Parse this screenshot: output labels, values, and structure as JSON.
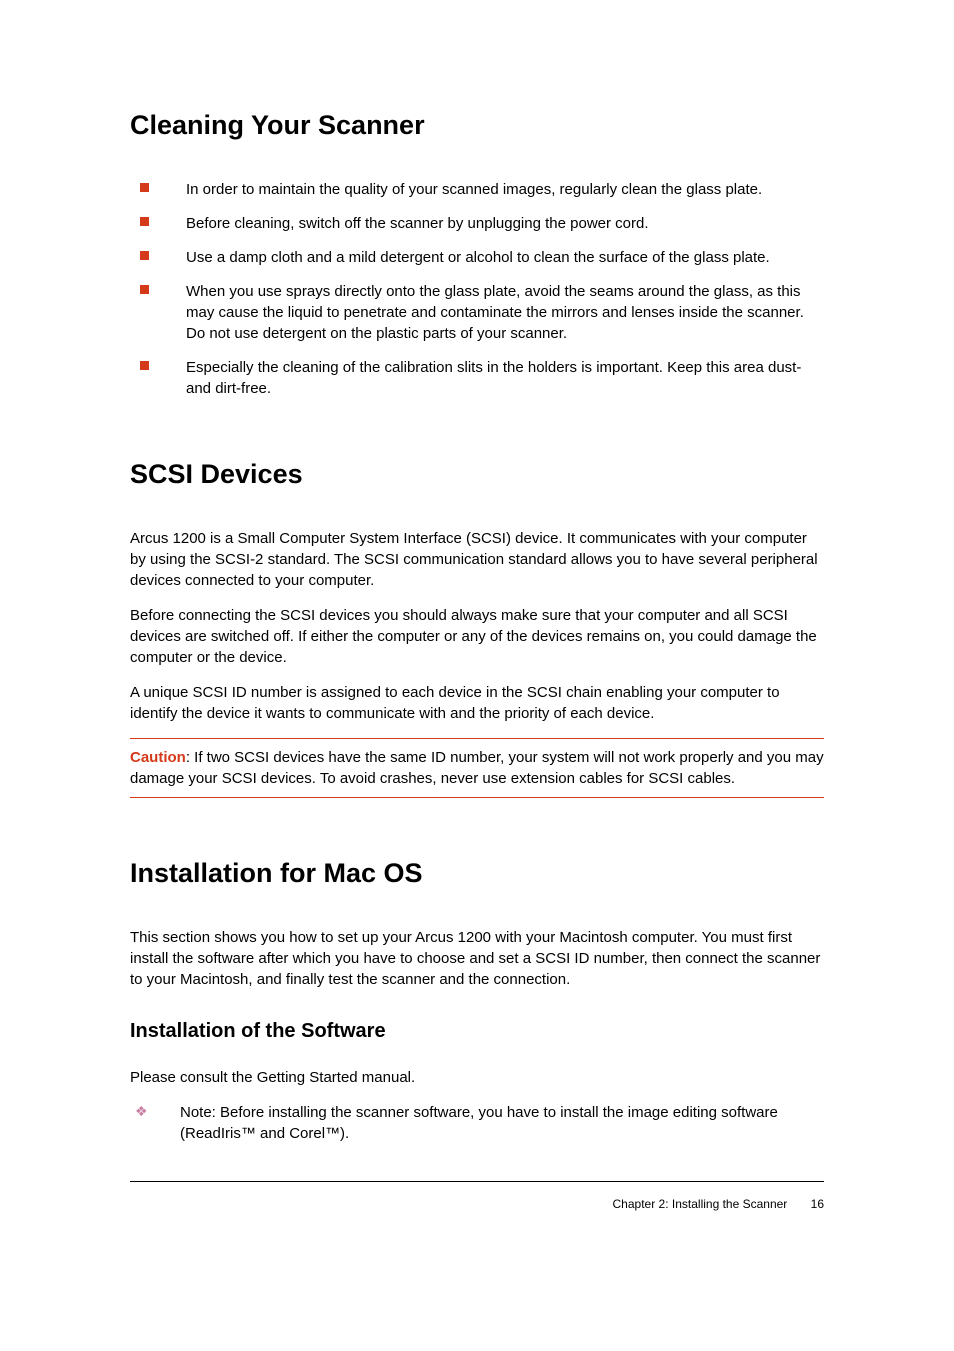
{
  "sections": {
    "cleaning": {
      "heading": "Cleaning Your Scanner",
      "bullets": [
        "In order to maintain the quality of your scanned images, regularly clean the glass plate.",
        "Before cleaning, switch off  the scanner by unplugging the power cord.",
        "Use a damp cloth and a mild detergent or alcohol to clean the surface of the glass plate.",
        "When you use sprays directly onto the glass plate, avoid the seams around the glass, as this may cause the liquid to penetrate and contaminate the mirrors and lenses inside the scanner. Do not use detergent on the plastic parts of your scanner.",
        "Especially the cleaning of the calibration slits in the holders is important. Keep this area dust- and dirt-free."
      ]
    },
    "scsi": {
      "heading": "SCSI Devices",
      "paragraphs": [
        "Arcus 1200 is a Small Computer System Interface (SCSI) device. It communicates with your computer by using the SCSI-2 standard. The SCSI communication standard allows you to have several peripheral devices connected to your computer.",
        "Before connecting the SCSI devices you should always make sure that your computer and all SCSI devices are switched off. If either the computer or any of the devices remains on, you could damage the computer or the device.",
        "A unique SCSI ID number is assigned to each device in the SCSI chain enabling your computer to identify the device it wants to communicate with and the priority of each device."
      ],
      "caution_label": "Caution",
      "caution_text": ": If two SCSI devices have the same ID number, your system will not work properly and you may damage your SCSI devices. To avoid crashes, never use extension cables for SCSI cables."
    },
    "mac": {
      "heading": "Installation for Mac OS",
      "intro": "This section shows you how to set up your Arcus 1200 with your Macintosh computer. You must first install the software after which you have to choose and set a SCSI ID number, then connect the scanner to your Macintosh, and finally test the scanner and the connection.",
      "subheading": "Installation of the Software",
      "subtext": "Please consult the Getting Started manual.",
      "note": "Note: Before installing the scanner software, you have to install the image editing software (ReadIris™ and Corel™)."
    }
  },
  "footer": {
    "chapter": "Chapter 2: Installing the Scanner",
    "page": "16"
  }
}
